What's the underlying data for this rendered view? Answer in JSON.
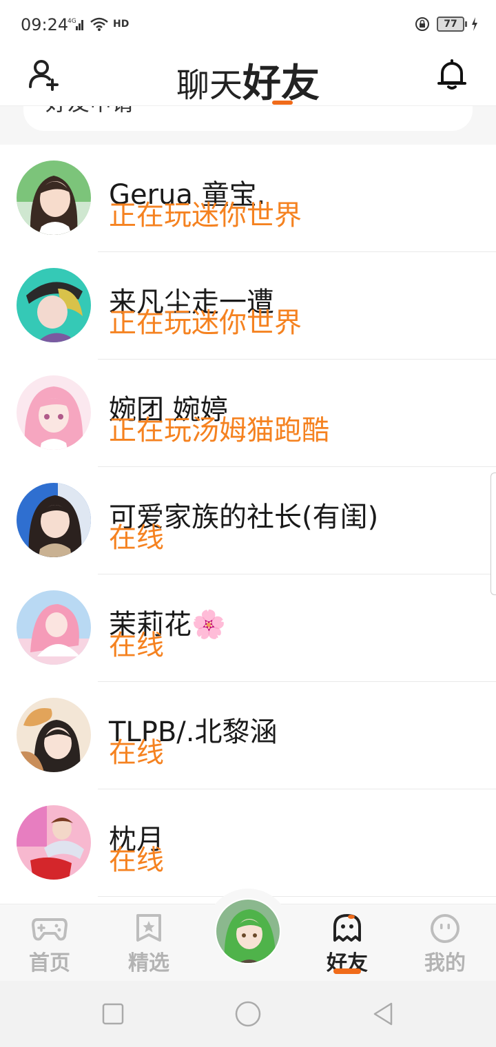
{
  "status_bar": {
    "time": "09:24",
    "network": "4G",
    "hd": "HD",
    "battery": "77"
  },
  "header": {
    "tab_chat": "聊天",
    "tab_friends": "好友",
    "accent_color": "#f06b1a"
  },
  "request_card": {
    "label": "好友申请"
  },
  "friends": [
    {
      "name": "Gerua 童宝.",
      "status": "正在玩迷你世界"
    },
    {
      "name": "来凡尘走一遭",
      "status": "正在玩迷你世界"
    },
    {
      "name": "婉团 婉婷",
      "status": "正在玩汤姆猫跑酷"
    },
    {
      "name": "可爱家族的社长(有闺)",
      "status": "在线"
    },
    {
      "name": "茉莉花🌸",
      "status": "在线"
    },
    {
      "name": "TLPB/.北黎涵",
      "status": "在线"
    },
    {
      "name": "枕月",
      "status": "在线"
    }
  ],
  "status_color": "#f58220",
  "tabbar": {
    "home": "首页",
    "featured": "精选",
    "friends": "好友",
    "mine": "我的"
  },
  "icons": {
    "add_friend": "add-user-icon",
    "notifications": "bell-icon",
    "home": "gamepad-icon",
    "featured": "star-bookmark-icon",
    "friends": "ghost-icon",
    "mine": "smiley-icon"
  }
}
